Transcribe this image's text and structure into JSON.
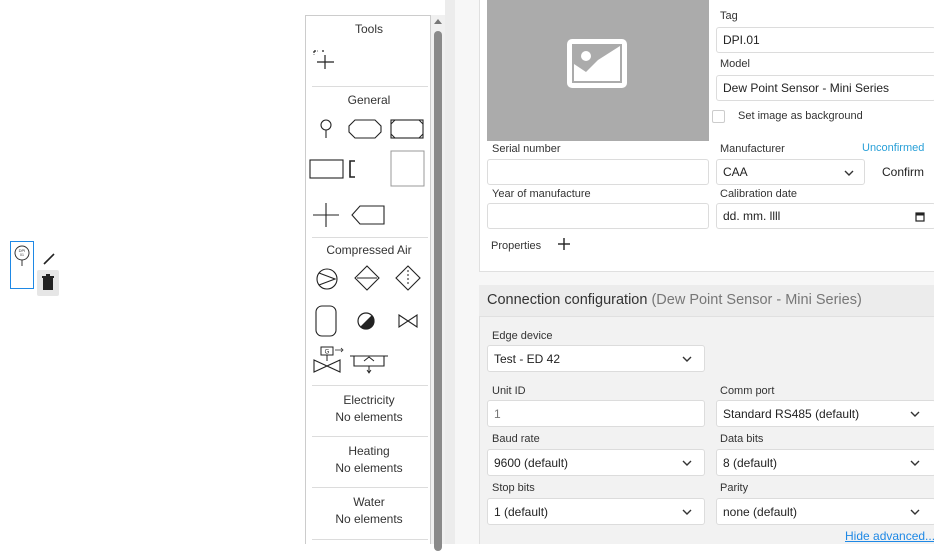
{
  "canvas": {
    "element_icon": "dew-point-sensor-icon",
    "element_tag": "DPI.01"
  },
  "context_menu": {
    "edit_icon": "pen-icon",
    "delete_icon": "trash-icon"
  },
  "tools": {
    "title": "Tools",
    "general_title": "General",
    "compressed_air_title": "Compressed Air",
    "categories": [
      {
        "name": "Electricity",
        "status": "No elements"
      },
      {
        "name": "Heating",
        "status": "No elements"
      },
      {
        "name": "Water",
        "status": "No elements"
      }
    ]
  },
  "device": {
    "tag_label": "Tag",
    "tag_value": "DPI.01",
    "model_label": "Model",
    "model_value": "Dew Point Sensor - Mini Series",
    "set_bg_label": "Set image as background",
    "serial_label": "Serial number",
    "serial_value": "",
    "manufacturer_label": "Manufacturer",
    "manufacturer_status": "Unconfirmed",
    "manufacturer_value": "CAA",
    "confirm_label": "Confirm",
    "year_label": "Year of manufacture",
    "year_value": "",
    "calibration_label": "Calibration date",
    "calibration_placeholder": "dd. mm. llll",
    "properties_label": "Properties",
    "add_property_icon": "plus-icon"
  },
  "connection": {
    "title": "Connection configuration",
    "subtitle": "(Dew Point Sensor - Mini Series)",
    "edge_label": "Edge device",
    "edge_value": "Test - ED 42",
    "unit_label": "Unit ID",
    "unit_value": "1",
    "comm_label": "Comm port",
    "comm_value": "Standard RS485 (default)",
    "baud_label": "Baud rate",
    "baud_value": "9600 (default)",
    "databits_label": "Data bits",
    "databits_value": "8 (default)",
    "stopbits_label": "Stop bits",
    "stopbits_value": "1 (default)",
    "parity_label": "Parity",
    "parity_value": "none (default)",
    "hide_advanced_label": "Hide advanced..."
  }
}
